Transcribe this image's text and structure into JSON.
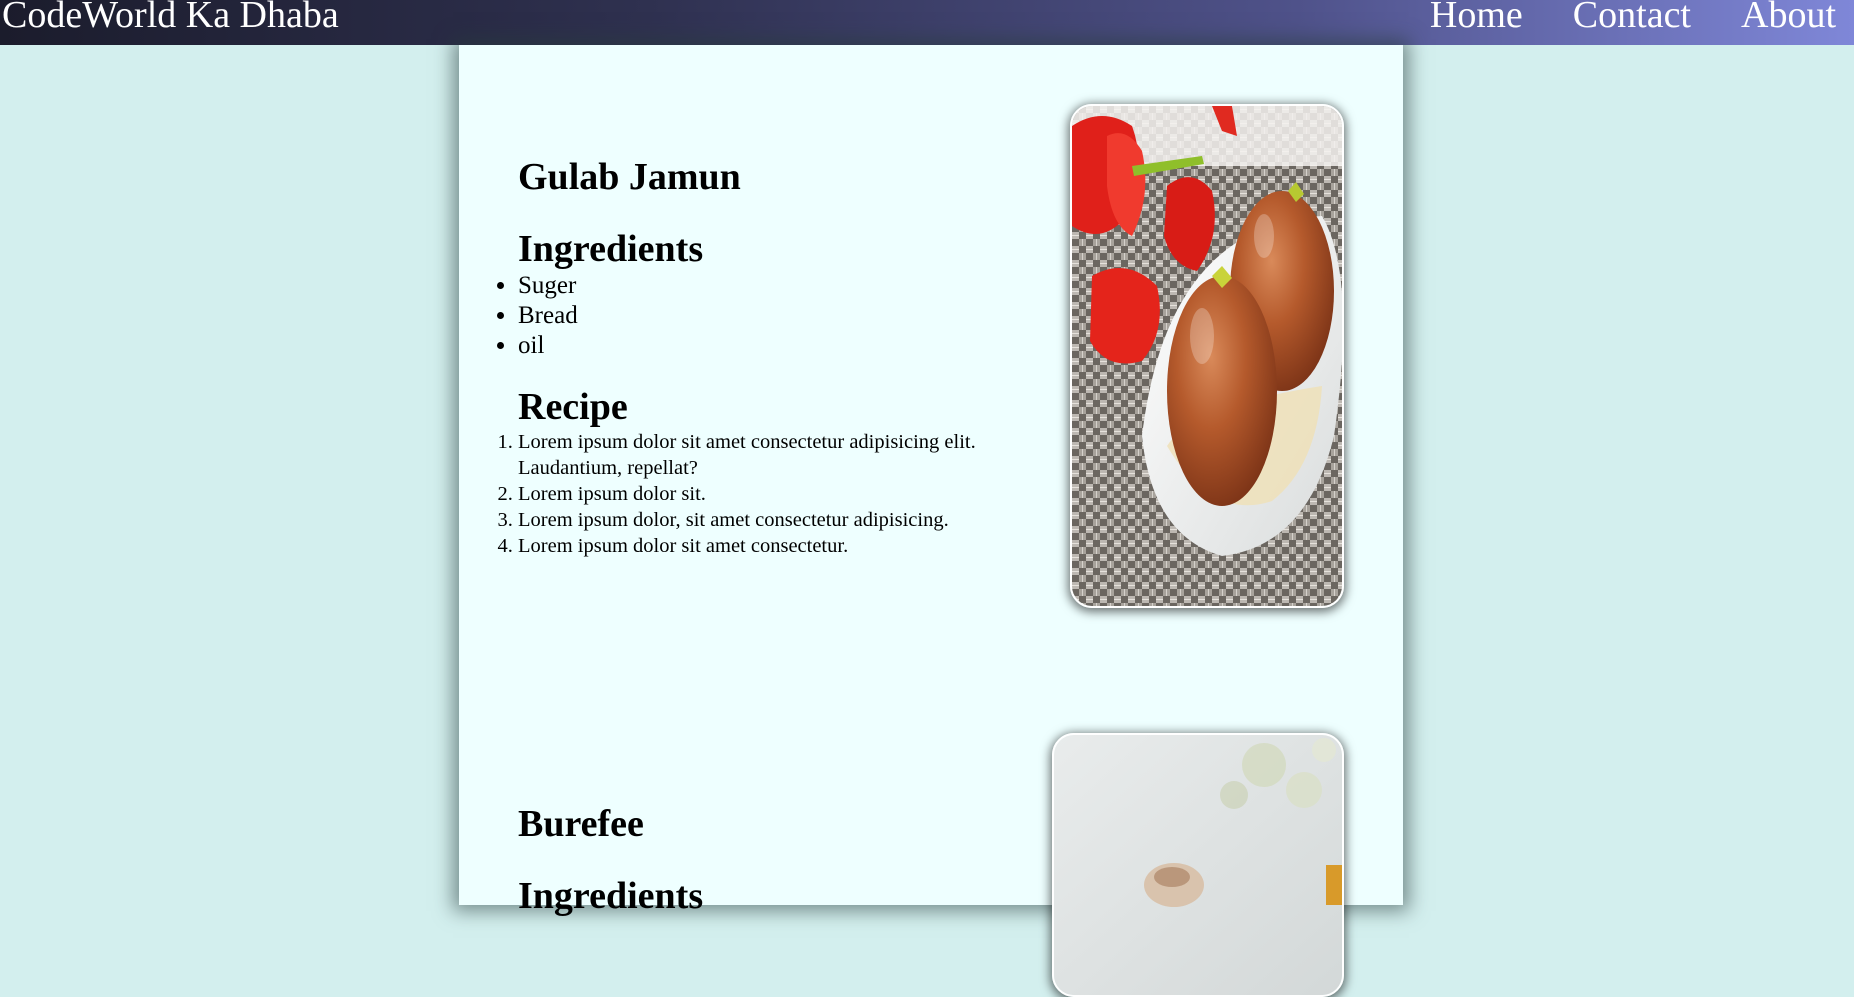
{
  "navbar": {
    "brand": "CodeWorld Ka Dhaba",
    "links": [
      "Home",
      "Contact",
      "About"
    ]
  },
  "recipes": [
    {
      "title": "Gulab Jamun",
      "ingredients_heading": "Ingredients",
      "ingredients": [
        "Suger",
        "Bread",
        "oil"
      ],
      "recipe_heading": "Recipe",
      "steps": [
        "Lorem ipsum dolor sit amet consectetur adipisicing elit. Laudantium, repellat?",
        "Lorem ipsum dolor sit.",
        "Lorem ipsum dolor, sit amet consectetur adipisicing.",
        "Lorem ipsum dolor sit amet consectetur."
      ]
    },
    {
      "title": "Burefee",
      "ingredients_heading": "Ingredients"
    }
  ],
  "colors": {
    "page_background": "#d3efee",
    "card_background": "#eeffff",
    "navbar_gradient_start": "#1b1c2c",
    "navbar_gradient_end": "#7f87d8"
  }
}
